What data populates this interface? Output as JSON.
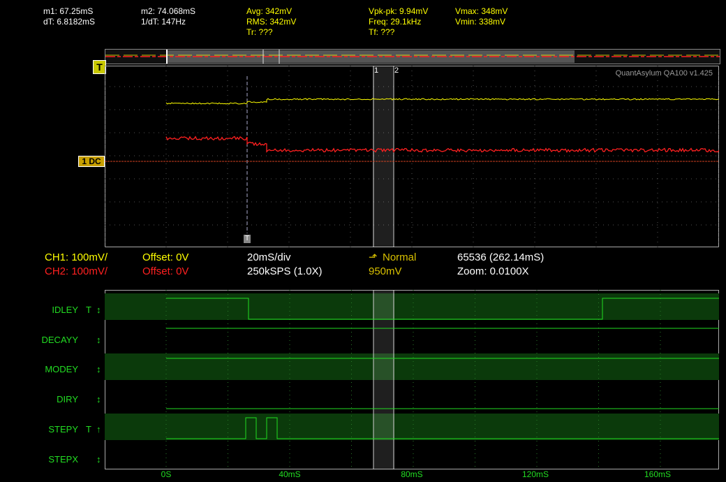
{
  "header": {
    "m1": "m1: 67.25mS",
    "dt": "dT: 6.8182mS",
    "m2": "m2: 74.068mS",
    "inv_dt": "1/dT: 147Hz",
    "avg": "Avg: 342mV",
    "rms": "RMS: 342mV",
    "tr": "Tr: ???",
    "vpkpk": "Vpk-pk: 9.94mV",
    "freq": "Freq: 29.1kHz",
    "tf": "Tf: ???",
    "vmax": "Vmax: 348mV",
    "vmin": "Vmin: 338mV"
  },
  "scope": {
    "trigger_label": "T",
    "cursor1_label": "1",
    "cursor2_label": "2",
    "watermark": "QuantAsylum QA100 v1.425",
    "ch_marker": "1 DC",
    "trigger_marker": "T",
    "ch1_color": "#ffff00",
    "ch2_color": "#ff2020"
  },
  "settings": {
    "ch1": "CH1: 100mV/",
    "ch1_offset": "Offset: 0V",
    "ch2": "CH2: 100mV/",
    "ch2_offset": "Offset: 0V",
    "timebase": "20mS/div",
    "samplerate": "250kSPS (1.0X)",
    "trigger_icon": "⬏",
    "trigger_mode": "Normal",
    "trigger_level": "950mV",
    "samples": "65536 (262.14mS)",
    "zoom": "Zoom: 0.0100X"
  },
  "digital": {
    "channels": [
      {
        "name": "IDLEY",
        "flag": "T",
        "arrow": "↕"
      },
      {
        "name": "DECAYY",
        "flag": "",
        "arrow": "↕"
      },
      {
        "name": "MODEY",
        "flag": "",
        "arrow": "↕"
      },
      {
        "name": "DIRY",
        "flag": "",
        "arrow": "↕"
      },
      {
        "name": "STEPY",
        "flag": "T",
        "arrow": "↑"
      },
      {
        "name": "STEPX",
        "flag": "",
        "arrow": "↕"
      }
    ],
    "x_ticks": [
      "0S",
      "40mS",
      "80mS",
      "120mS",
      "160mS"
    ]
  }
}
